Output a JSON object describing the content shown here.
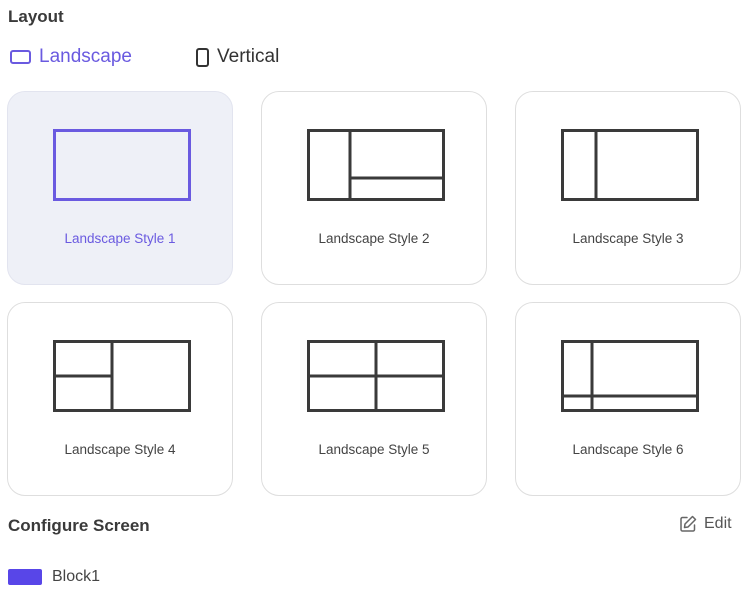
{
  "layout": {
    "title": "Layout",
    "orientations": {
      "landscape": "Landscape",
      "vertical": "Vertical"
    },
    "selected_orientation": "Landscape",
    "styles": [
      {
        "label": "Landscape Style 1",
        "selected": true
      },
      {
        "label": "Landscape Style 2",
        "selected": false
      },
      {
        "label": "Landscape Style 3",
        "selected": false
      },
      {
        "label": "Landscape Style 4",
        "selected": false
      },
      {
        "label": "Landscape Style 5",
        "selected": false
      },
      {
        "label": "Landscape Style 6",
        "selected": false
      }
    ]
  },
  "configure": {
    "title": "Configure Screen",
    "edit_label": "Edit",
    "blocks": [
      {
        "label": "Block1",
        "color": "#5846e8"
      }
    ]
  },
  "colors": {
    "accent": "#6a5ae0",
    "selected_card_bg": "#eef0f7",
    "layout_lines": "#3a3a3a",
    "block_color": "#5846e8"
  },
  "icons": {
    "landscape": "landscape-rect-icon",
    "vertical": "portrait-rect-icon",
    "edit": "edit-pencil-icon"
  }
}
